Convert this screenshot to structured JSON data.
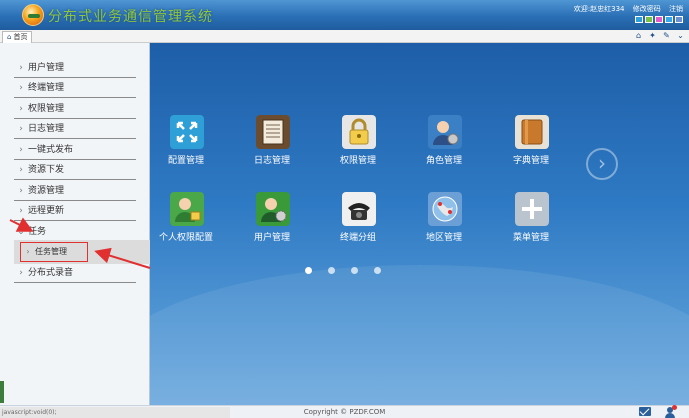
{
  "header": {
    "title": "分布式业务通信管理系统",
    "welcome": "欢迎:赵忠红334",
    "change_password": "修改密码",
    "logout": "注销",
    "skin_colors": [
      "#2e9fd8",
      "#7ac143",
      "#e45ac6",
      "#38a7e8",
      "#6c8fd0"
    ]
  },
  "tabbar": {
    "home_tab": "首页",
    "tools": [
      "home-icon",
      "shirt-icon",
      "edit-icon",
      "chevron-down-icon"
    ]
  },
  "sidebar": {
    "items": [
      {
        "label": "用户管理"
      },
      {
        "label": "终端管理"
      },
      {
        "label": "权限管理"
      },
      {
        "label": "日志管理"
      },
      {
        "label": "一键式发布"
      },
      {
        "label": "资源下发"
      },
      {
        "label": "资源管理"
      },
      {
        "label": "远程更新"
      },
      {
        "label": "任务"
      },
      {
        "label": "分布式录音"
      }
    ],
    "sub_item": "任务管理"
  },
  "main": {
    "tiles": [
      {
        "label": "配置管理",
        "icon": "config-icon",
        "color": "#2f9fd8"
      },
      {
        "label": "日志管理",
        "icon": "log-icon",
        "color": "#7a5a3a"
      },
      {
        "label": "权限管理",
        "icon": "lock-icon",
        "color": "#e8c450"
      },
      {
        "label": "角色管理",
        "icon": "role-icon",
        "color": "#3b7fc4"
      },
      {
        "label": "字典管理",
        "icon": "book-icon",
        "color": "#c98a3c"
      },
      {
        "label": "个人权限配置",
        "icon": "person-lock-icon",
        "color": "#4aa848"
      },
      {
        "label": "用户管理",
        "icon": "user-gear-icon",
        "color": "#3a9a3a"
      },
      {
        "label": "终端分组",
        "icon": "phone-icon",
        "color": "#333333"
      },
      {
        "label": "地区管理",
        "icon": "map-icon",
        "color": "#4a7fc0"
      },
      {
        "label": "菜单管理",
        "icon": "plus-icon",
        "color": "#9aa8b6"
      }
    ],
    "page_dots": 4
  },
  "footer": {
    "status": "javascript:void(0);",
    "copyright": "Copyright © PZDF.COM"
  }
}
